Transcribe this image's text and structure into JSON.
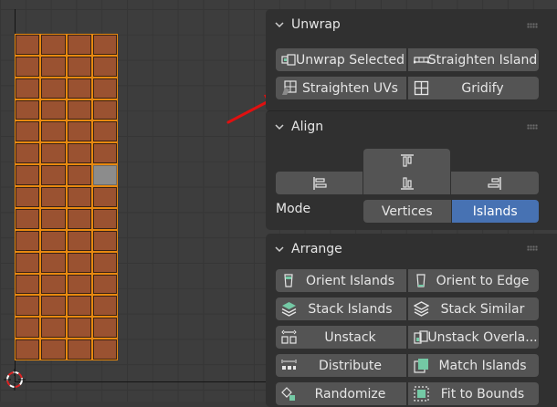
{
  "panels": {
    "unwrap": {
      "title": "Unwrap",
      "buttons": [
        {
          "label": "Unwrap Selected",
          "icon": "unwrap-icon"
        },
        {
          "label": "Straighten Island",
          "icon": "straighten-island-icon"
        },
        {
          "label": "Straighten UVs",
          "icon": "straighten-uvs-icon"
        },
        {
          "label": "Gridify",
          "icon": "gridify-icon"
        }
      ]
    },
    "align": {
      "title": "Align",
      "buttons": [
        "align-top-icon",
        "align-left-icon",
        "align-center-icon",
        "align-right-icon"
      ],
      "mode_label": "Mode",
      "mode_options": [
        "Vertices",
        "Islands"
      ],
      "mode_selected": "Islands"
    },
    "arrange": {
      "title": "Arrange",
      "buttons": [
        {
          "label": "Orient Islands",
          "icon": "orient-islands-icon"
        },
        {
          "label": "Orient to Edge",
          "icon": "orient-edge-icon"
        },
        {
          "label": "Stack Islands",
          "icon": "stack-islands-icon"
        },
        {
          "label": "Stack Similar",
          "icon": "stack-similar-icon"
        },
        {
          "label": "Unstack",
          "icon": "unstack-icon"
        },
        {
          "label": "Unstack Overla...",
          "icon": "unstack-overlap-icon"
        },
        {
          "label": "Distribute",
          "icon": "distribute-icon"
        },
        {
          "label": "Match Islands",
          "icon": "match-islands-icon"
        },
        {
          "label": "Randomize",
          "icon": "randomize-icon"
        },
        {
          "label": "Fit to Bounds",
          "icon": "fit-bounds-icon"
        }
      ]
    }
  },
  "uv_grid": {
    "columns": 4,
    "rows": 15,
    "selected_face": {
      "row": 6,
      "col": 3
    }
  },
  "colors": {
    "accent": "#4772b3",
    "uv_face": "#9a5231",
    "uv_edge": "#e8890f",
    "selected_face": "#8c8c8c",
    "annotation_arrow": "#e01010",
    "button": "#545454",
    "panel": "#303030"
  }
}
